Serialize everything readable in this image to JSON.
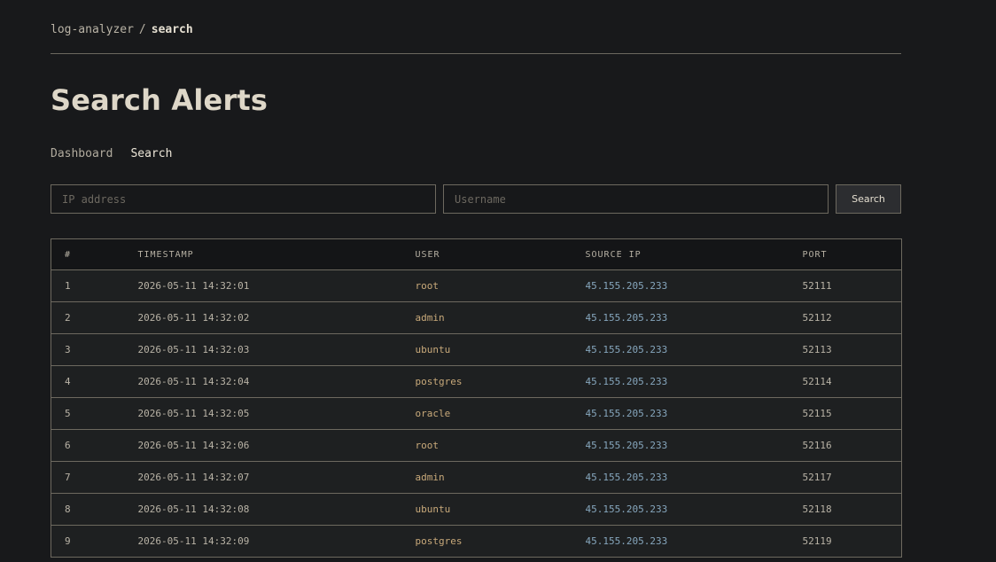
{
  "breadcrumb": {
    "root": "log-analyzer",
    "separator": "/",
    "current": "search"
  },
  "page_title": "Search Alerts",
  "nav": {
    "items": [
      {
        "label": "Dashboard",
        "active": false
      },
      {
        "label": "Search",
        "active": true
      }
    ]
  },
  "search": {
    "ip_placeholder": "IP address",
    "ip_value": "",
    "username_placeholder": "Username",
    "username_value": "",
    "button_label": "Search"
  },
  "table": {
    "columns": [
      "#",
      "TIMESTAMP",
      "USER",
      "SOURCE IP",
      "PORT"
    ],
    "rows": [
      {
        "num": "1",
        "timestamp": "2026-05-11 14:32:01",
        "user": "root",
        "ip": "45.155.205.233",
        "port": "52111"
      },
      {
        "num": "2",
        "timestamp": "2026-05-11 14:32:02",
        "user": "admin",
        "ip": "45.155.205.233",
        "port": "52112"
      },
      {
        "num": "3",
        "timestamp": "2026-05-11 14:32:03",
        "user": "ubuntu",
        "ip": "45.155.205.233",
        "port": "52113"
      },
      {
        "num": "4",
        "timestamp": "2026-05-11 14:32:04",
        "user": "postgres",
        "ip": "45.155.205.233",
        "port": "52114"
      },
      {
        "num": "5",
        "timestamp": "2026-05-11 14:32:05",
        "user": "oracle",
        "ip": "45.155.205.233",
        "port": "52115"
      },
      {
        "num": "6",
        "timestamp": "2026-05-11 14:32:06",
        "user": "root",
        "ip": "45.155.205.233",
        "port": "52116"
      },
      {
        "num": "7",
        "timestamp": "2026-05-11 14:32:07",
        "user": "admin",
        "ip": "45.155.205.233",
        "port": "52117"
      },
      {
        "num": "8",
        "timestamp": "2026-05-11 14:32:08",
        "user": "ubuntu",
        "ip": "45.155.205.233",
        "port": "52118"
      },
      {
        "num": "9",
        "timestamp": "2026-05-11 14:32:09",
        "user": "postgres",
        "ip": "45.155.205.233",
        "port": "52119"
      }
    ]
  },
  "colors": {
    "background": "#18191b",
    "user_accent": "#c8a97a",
    "ip_accent": "#86a6bd",
    "border": "#6d695f"
  }
}
